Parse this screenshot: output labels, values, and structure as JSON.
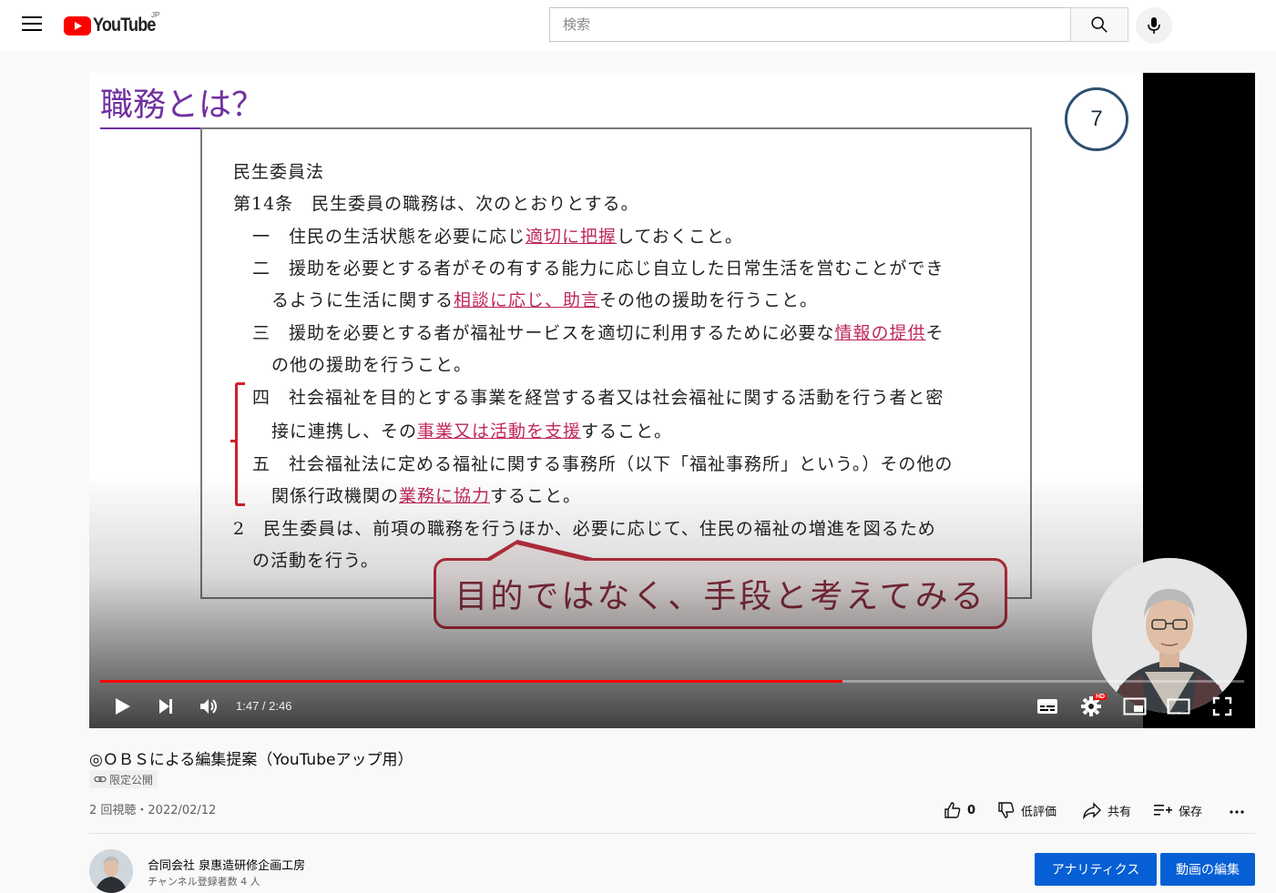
{
  "masthead": {
    "logo_text": "YouTube",
    "logo_region": "JP",
    "search_placeholder": "検索"
  },
  "slide": {
    "title": "職務とは？",
    "page_number": "7",
    "lines": [
      {
        "pre": "民生委員法",
        "hl": "",
        "post": ""
      },
      {
        "pre": "第14条　民生委員の職務は、次のとおりとする。",
        "hl": "",
        "post": ""
      },
      {
        "pre": "一　住民の生活状態を必要に応じ",
        "hl": "適切に把握",
        "post": "しておくこと。"
      },
      {
        "pre": "二　援助を必要とする者がその有する能力に応じ自立した日常生活を営むことができ",
        "hl": "",
        "post": ""
      },
      {
        "pre": "るように生活に関する",
        "hl": "相談に応じ、助言",
        "post": "その他の援助を行うこと。"
      },
      {
        "pre": "三　援助を必要とする者が福祉サービスを適切に利用するために必要な",
        "hl": "情報の提供",
        "post": "そ"
      },
      {
        "pre": "の他の援助を行うこと。",
        "hl": "",
        "post": ""
      },
      {
        "pre": "四　社会福祉を目的とする事業を経営する者又は社会福祉に関する活動を行う者と密",
        "hl": "",
        "post": ""
      },
      {
        "pre": "接に連携し、その",
        "hl": "事業又は活動を支援",
        "post": "すること。"
      },
      {
        "pre": "五　社会福祉法に定める福祉に関する事務所（以下「福祉事務所」という。）その他の",
        "hl": "",
        "post": ""
      },
      {
        "pre": "関係行政機関の",
        "hl": "業務に協力",
        "post": "すること。"
      },
      {
        "pre": "2　民生委員は、前項の職務を行うほか、必要に応じて、住民の福祉の増進を図るため",
        "hl": "",
        "post": ""
      },
      {
        "pre": "の活動を行う。",
        "hl": "",
        "post": ""
      }
    ],
    "callout": "目的ではなく、手段と考えてみる"
  },
  "player": {
    "time": "1:47 / 2:46",
    "progress_fraction": 0.649,
    "hd_badge": "HD"
  },
  "video": {
    "title": "◎ＯＢＳによる編集提案（YouTubeアップ用）",
    "visibility": "限定公開",
    "views_date": "2 回視聴・2022/02/12",
    "like_count": "0",
    "dislike_label": "低評価",
    "share_label": "共有",
    "save_label": "保存"
  },
  "channel": {
    "name": "合同会社 泉惠造研修企画工房",
    "subscribers": "チャンネル登録者数 4 人",
    "analytics_label": "アナリティクス",
    "edit_label": "動画の編集"
  },
  "colors": {
    "brand_red": "#ff0000",
    "accent_blue": "#065fd4",
    "slide_title_purple": "#7030a0",
    "highlight_pink": "#c0285a"
  }
}
